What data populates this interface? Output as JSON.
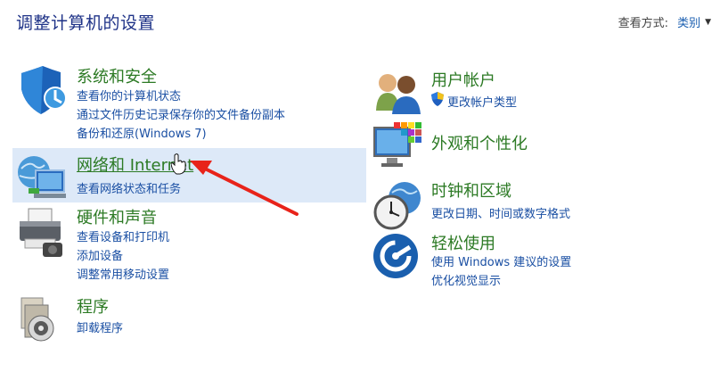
{
  "header": {
    "title": "调整计算机的设置",
    "view_by_label": "查看方式:",
    "view_by_value": "类别"
  },
  "left": [
    {
      "title": "系统和安全",
      "icon": "shield-icon",
      "links": [
        "查看你的计算机状态",
        "通过文件历史记录保存你的文件备份副本",
        "备份和还原(Windows 7)"
      ]
    },
    {
      "title": "网络和 Internet",
      "icon": "globe-network-icon",
      "links": [
        "查看网络状态和任务"
      ]
    },
    {
      "title": "硬件和声音",
      "icon": "printer-icon",
      "links": [
        "查看设备和打印机",
        "添加设备",
        "调整常用移动设置"
      ]
    },
    {
      "title": "程序",
      "icon": "programs-disc-icon",
      "links": [
        "卸载程序"
      ]
    }
  ],
  "right": [
    {
      "title": "用户帐户",
      "icon": "users-icon",
      "links": [
        "更改帐户类型"
      ]
    },
    {
      "title": "外观和个性化",
      "icon": "monitor-palette-icon",
      "links": []
    },
    {
      "title": "时钟和区域",
      "icon": "clock-globe-icon",
      "links": [
        "更改日期、时间或数字格式"
      ]
    },
    {
      "title": "轻松使用",
      "icon": "accessibility-icon",
      "links": [
        "使用 Windows 建议的设置",
        "优化视觉显示"
      ]
    }
  ],
  "colors": {
    "title": "#1e3287",
    "category": "#2c7a24",
    "link": "#1a4fa3",
    "highlight": "#dde9f8",
    "arrow": "#e8231a"
  }
}
